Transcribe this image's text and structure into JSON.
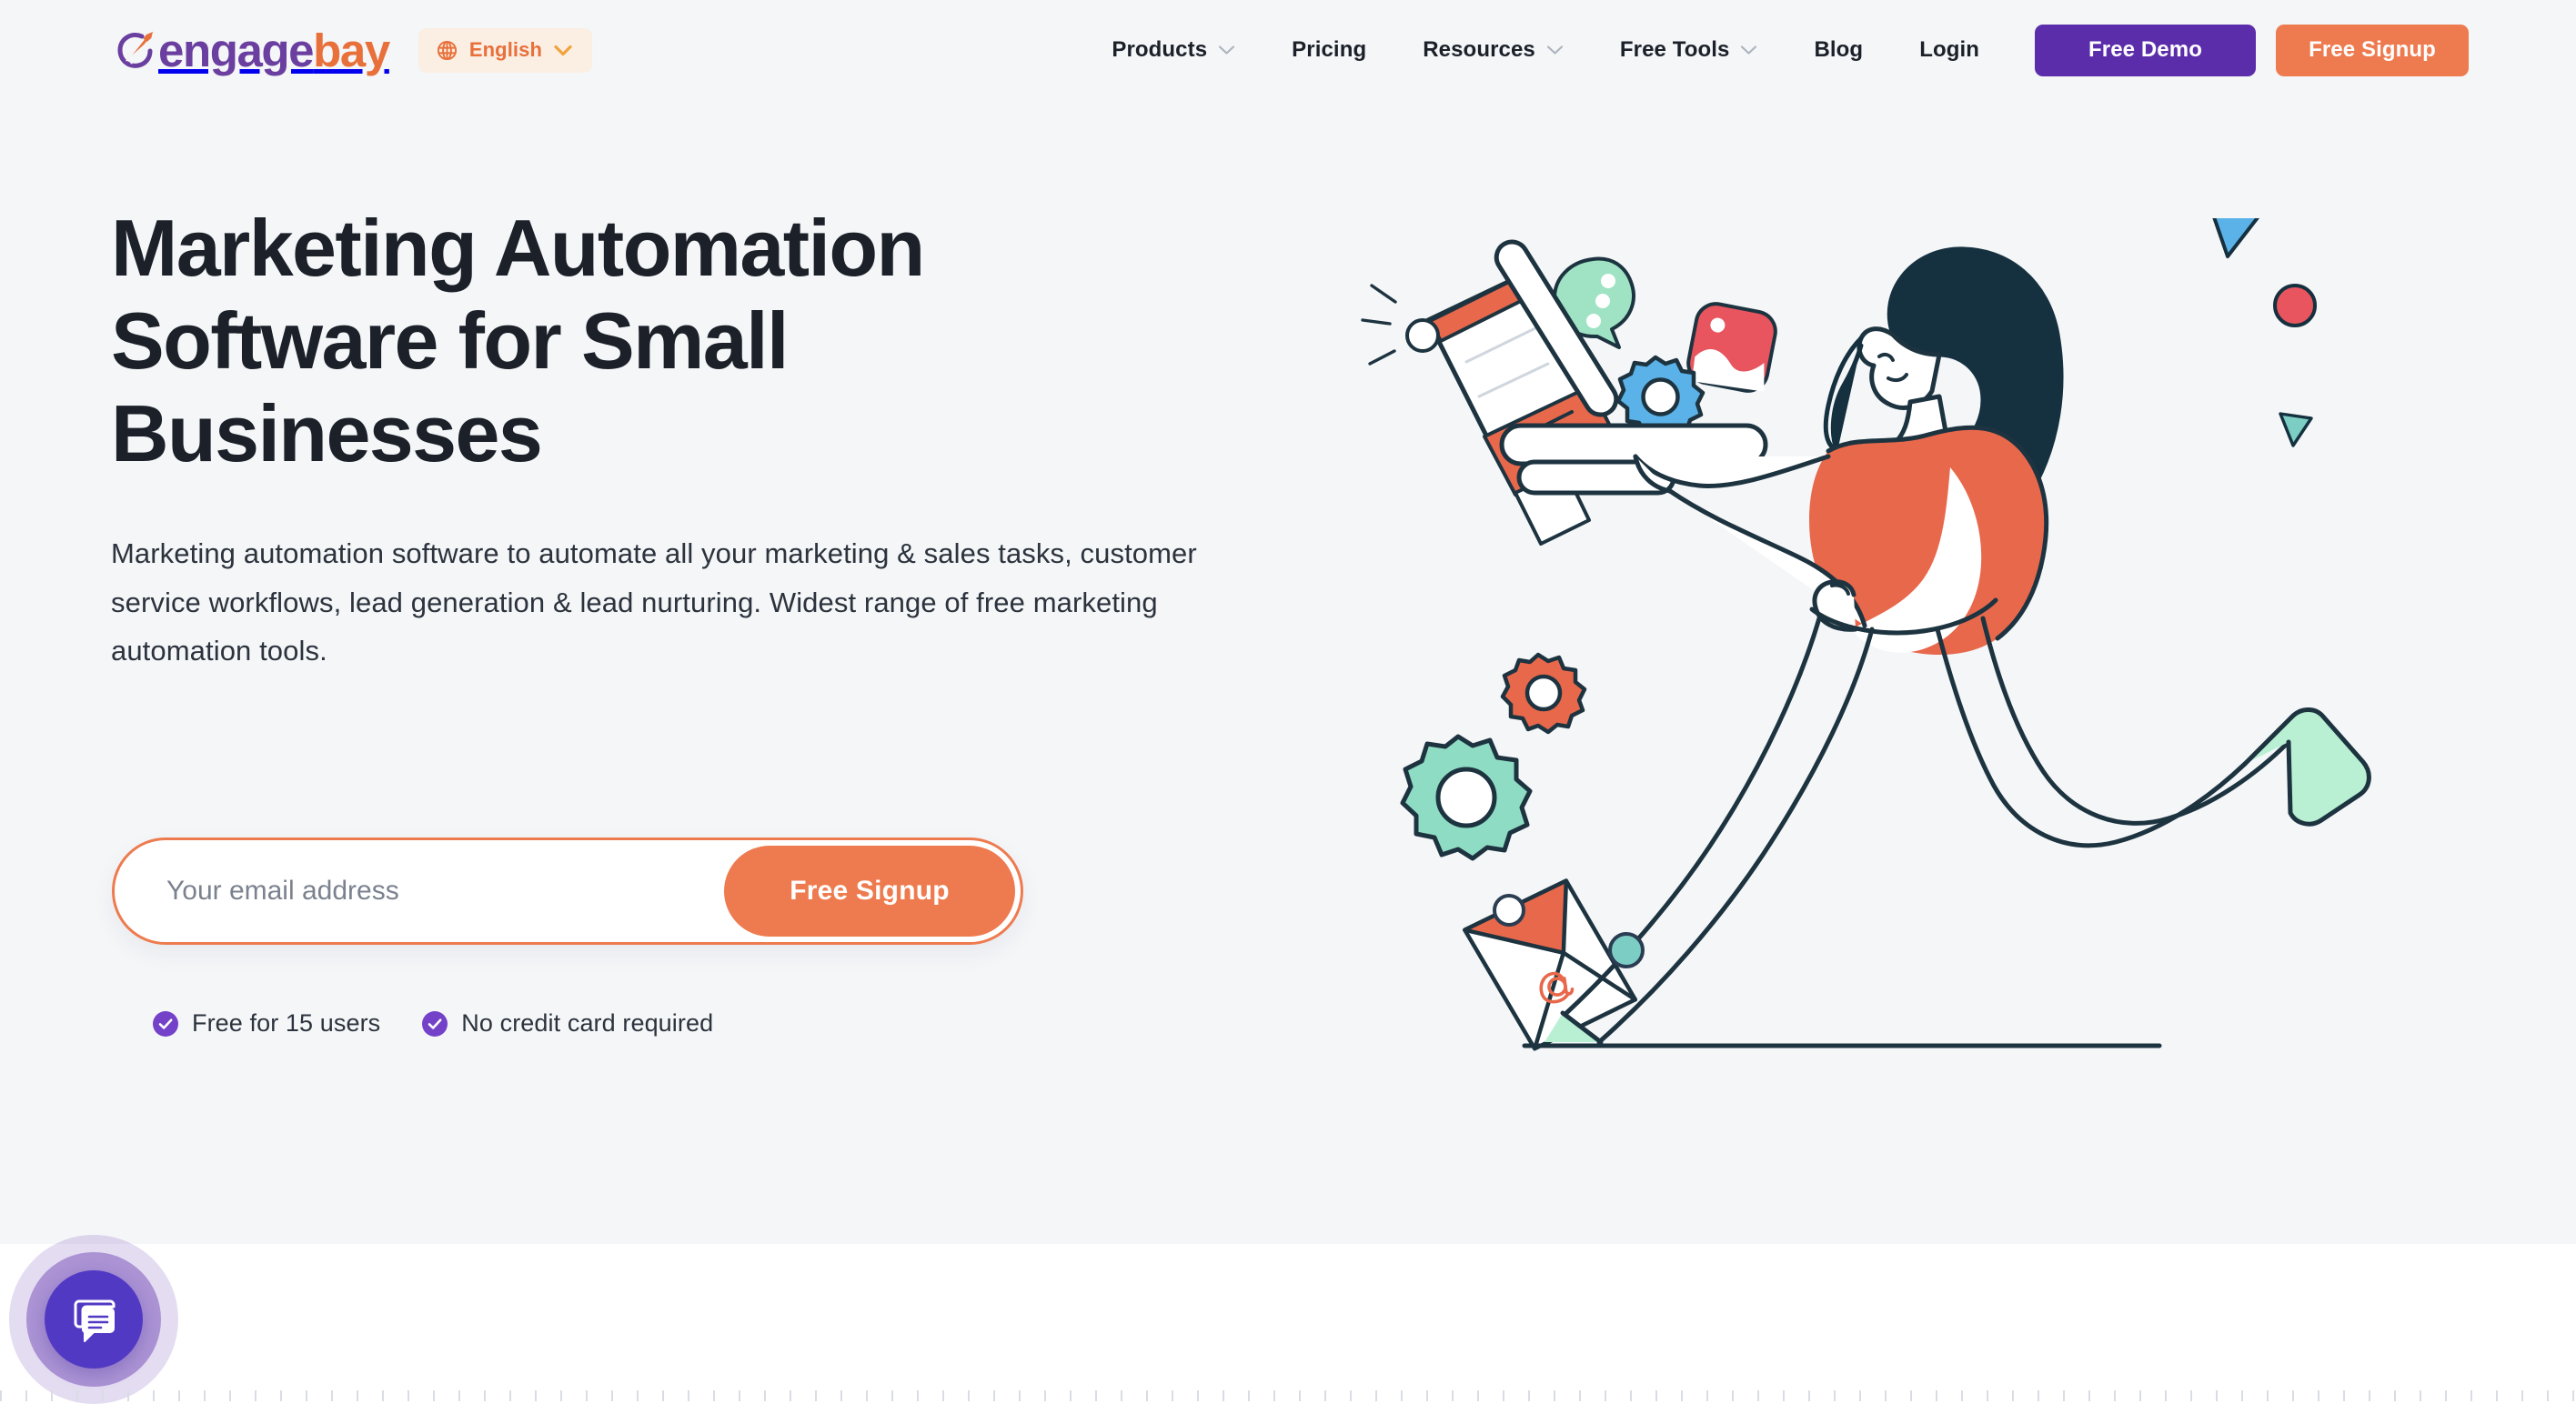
{
  "colors": {
    "page_bg": "#ffffff",
    "hero_bg": "#f4f6f8",
    "brand_purple": "#6b3fa0",
    "brand_orange": "#e8703a",
    "cta_purple": "#5c2dab",
    "cta_orange": "#ee7b4f",
    "text_dark": "#1b2029",
    "text_body": "#2c333d",
    "placeholder": "#7b828f",
    "check_purple": "#7442c8",
    "chat_purple": "#5239c4",
    "illus_ink": "#1d3440",
    "illus_coral": "#e8684c",
    "illus_mint": "#9fe3c4",
    "illus_teal": "#7ccdc4",
    "illus_blue": "#5bb2e8",
    "illus_red": "#e8555f"
  },
  "header": {
    "logo": {
      "mark_icon": "engagebay-swoosh-logo-icon",
      "word_part1": "engage",
      "word_part2": "bay"
    },
    "language_selector": {
      "icon": "globe-icon",
      "label": "English",
      "caret_icon": "chevron-down-icon"
    },
    "nav_items": [
      {
        "label": "Products",
        "has_caret": true
      },
      {
        "label": "Pricing",
        "has_caret": false
      },
      {
        "label": "Resources",
        "has_caret": true
      },
      {
        "label": "Free Tools",
        "has_caret": true
      },
      {
        "label": "Blog",
        "has_caret": false
      },
      {
        "label": "Login",
        "has_caret": false
      }
    ],
    "demo_button": "Free Demo",
    "signup_button": "Free Signup"
  },
  "hero": {
    "title_lines": [
      "Marketing Automation",
      "Software for Small",
      "Businesses"
    ],
    "title_full": "Marketing Automation Software for Small Businesses",
    "subtitle": "Marketing automation software to automate all your marketing & sales tasks, customer service workflows, lead generation & lead nurturing. Widest range of free marketing automation tools.",
    "signup_form": {
      "email_placeholder": "Your email address",
      "email_value": "",
      "submit_label": "Free Signup"
    },
    "assurances": [
      {
        "icon": "check-circle-icon",
        "label": "Free for 15 users"
      },
      {
        "icon": "check-circle-icon",
        "label": "No credit card required"
      }
    ],
    "illustration": {
      "name": "woman-running-with-laptop-illustration",
      "elements": [
        "megaphone-icon",
        "laptop-icon",
        "chat-bubble-icon",
        "photo-icon",
        "blue-gear-icon",
        "coral-gear-icon",
        "mint-gear-icon",
        "envelope-at-icon",
        "running-woman-figure",
        "blue-triangle-shape",
        "teal-triangle-shape",
        "red-circle-shape",
        "teal-circle-shape",
        "outline-circle-shape",
        "ground-line"
      ]
    }
  },
  "chat_widget": {
    "icon": "chat-bubbles-icon",
    "label": "Open live chat"
  }
}
